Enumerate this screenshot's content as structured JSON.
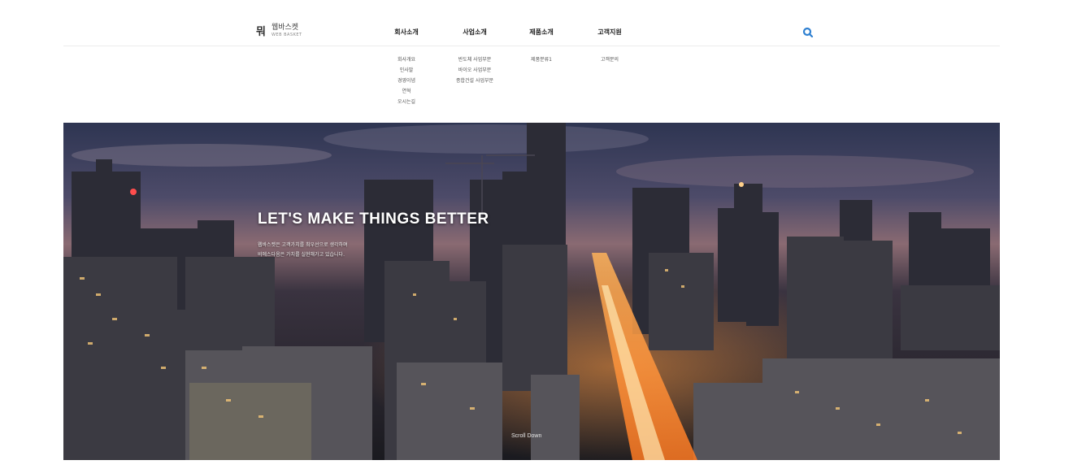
{
  "header": {
    "logo": {
      "mark": "뭐",
      "name": "웹바스켓",
      "sub": "WEB BASKET"
    },
    "nav": [
      {
        "title": "회사소개",
        "items": [
          "회사개요",
          "인사말",
          "경영이념",
          "연혁",
          "오시는길"
        ]
      },
      {
        "title": "사업소개",
        "items": [
          "반도체 사업부문",
          "바이오 사업부문",
          "종합건설 사업부문"
        ]
      },
      {
        "title": "제품소개",
        "items": [
          "제품분류1"
        ]
      },
      {
        "title": "고객지원",
        "items": [
          "고객문의"
        ]
      }
    ],
    "search": {
      "icon": "search-icon",
      "color": "#2f80d1"
    }
  },
  "hero": {
    "title": "LET'S MAKE THINGS BETTER",
    "desc_lines": [
      "웹바스켓은 고객가치를 최우선으로 생각하며",
      "비에스다음은 가치를 실현해가고 있습니다."
    ],
    "scroll_label": "Scroll Down"
  }
}
